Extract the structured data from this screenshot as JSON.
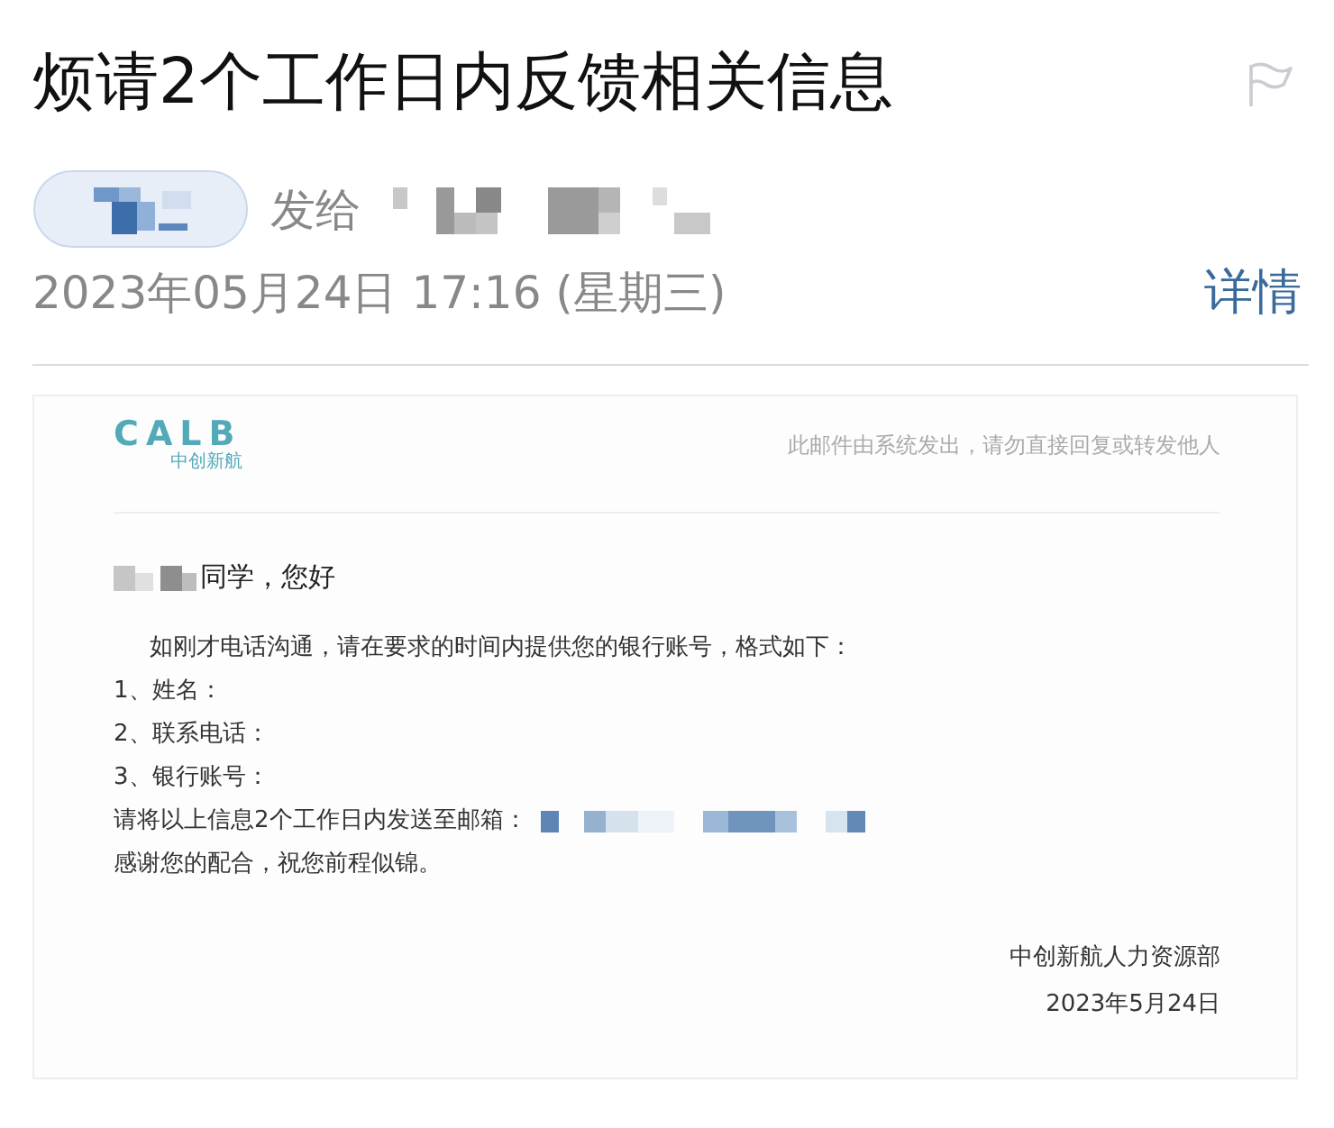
{
  "subject": "烦请2个工作日内反馈相关信息",
  "sender": {
    "to_label": "发给"
  },
  "date": "2023年05月24日 17:16 (星期三)",
  "details_link": "详情",
  "email": {
    "logo": {
      "name": "CALB",
      "subtitle": "中创新航"
    },
    "notice": "此邮件由系统发出，请勿直接回复或转发他人",
    "greeting": "同学，您好",
    "intro": "如刚才电话沟通，请在要求的时间内提供您的银行账号，格式如下：",
    "items": [
      "1、姓名：",
      "2、联系电话：",
      "3、银行账号："
    ],
    "request": "请将以上信息2个工作日内发送至邮箱：",
    "thanks": "感谢您的配合，祝您前程似锦。",
    "signature": "中创新航人力资源部",
    "signed_date": "2023年5月24日"
  }
}
